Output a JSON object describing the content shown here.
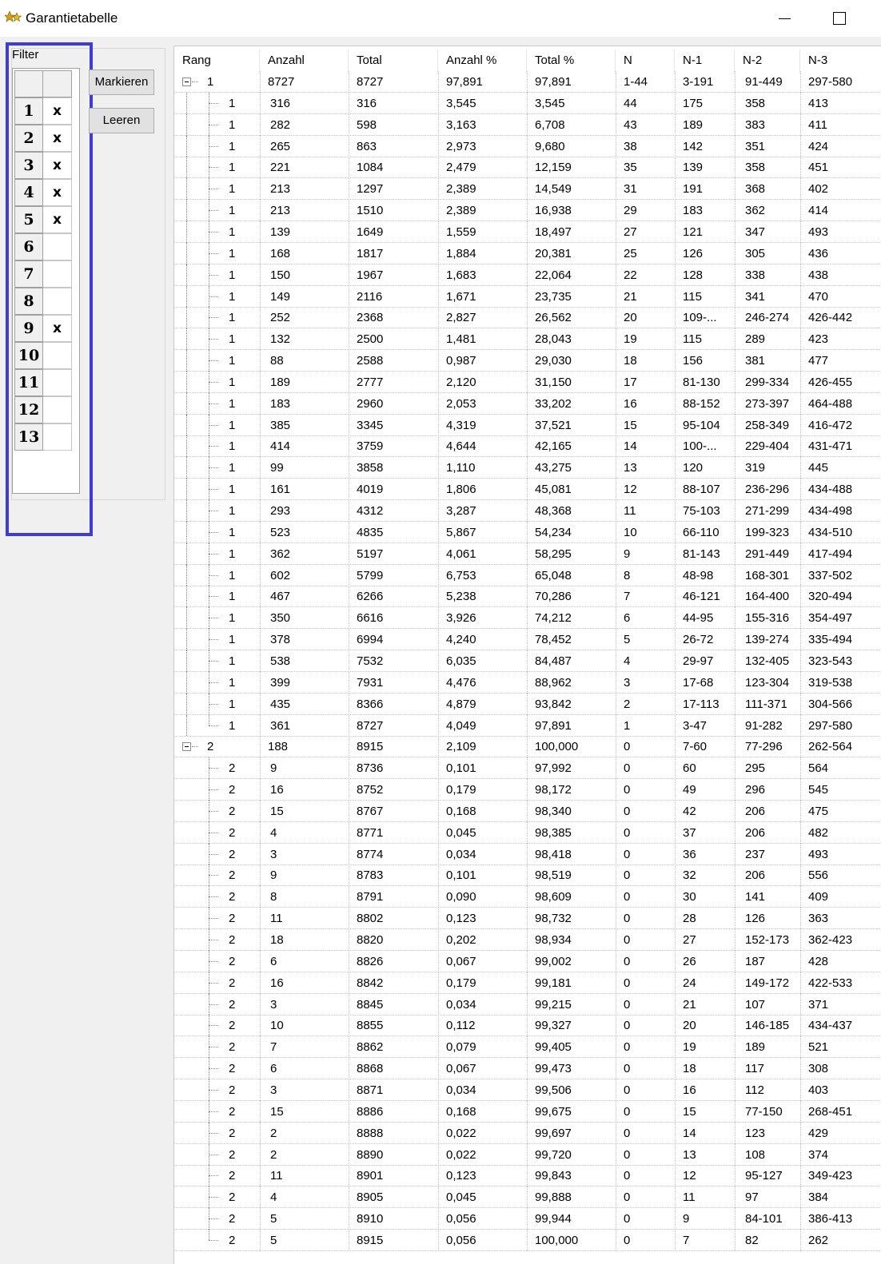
{
  "window": {
    "title": "Garantietabelle",
    "icon": "stars-icon"
  },
  "filter": {
    "caption": "Filter",
    "rows": [
      {
        "num": "1",
        "mark": "x"
      },
      {
        "num": "2",
        "mark": "x"
      },
      {
        "num": "3",
        "mark": "x"
      },
      {
        "num": "4",
        "mark": "x"
      },
      {
        "num": "5",
        "mark": "x"
      },
      {
        "num": "6",
        "mark": ""
      },
      {
        "num": "7",
        "mark": ""
      },
      {
        "num": "8",
        "mark": ""
      },
      {
        "num": "9",
        "mark": "x"
      },
      {
        "num": "10",
        "mark": ""
      },
      {
        "num": "11",
        "mark": ""
      },
      {
        "num": "12",
        "mark": ""
      },
      {
        "num": "13",
        "mark": ""
      }
    ],
    "highlight_color": "#3d3dd6"
  },
  "buttons": {
    "markieren": "Markieren",
    "leeren": "Leeren"
  },
  "table": {
    "columns": [
      "Rang",
      "Anzahl",
      "Total",
      "Anzahl %",
      "Total %",
      "N",
      "N-1",
      "N-2",
      "N-3"
    ],
    "groups": [
      {
        "summary": [
          "1",
          "8727",
          "8727",
          "97,891",
          "97,891",
          "1-44",
          "3-191",
          "91-449",
          "297-580"
        ],
        "children": [
          [
            "1",
            "316",
            "316",
            "3,545",
            "3,545",
            "44",
            "175",
            "358",
            "413"
          ],
          [
            "1",
            "282",
            "598",
            "3,163",
            "6,708",
            "43",
            "189",
            "383",
            "411"
          ],
          [
            "1",
            "265",
            "863",
            "2,973",
            "9,680",
            "38",
            "142",
            "351",
            "424"
          ],
          [
            "1",
            "221",
            "1084",
            "2,479",
            "12,159",
            "35",
            "139",
            "358",
            "451"
          ],
          [
            "1",
            "213",
            "1297",
            "2,389",
            "14,549",
            "31",
            "191",
            "368",
            "402"
          ],
          [
            "1",
            "213",
            "1510",
            "2,389",
            "16,938",
            "29",
            "183",
            "362",
            "414"
          ],
          [
            "1",
            "139",
            "1649",
            "1,559",
            "18,497",
            "27",
            "121",
            "347",
            "493"
          ],
          [
            "1",
            "168",
            "1817",
            "1,884",
            "20,381",
            "25",
            "126",
            "305",
            "436"
          ],
          [
            "1",
            "150",
            "1967",
            "1,683",
            "22,064",
            "22",
            "128",
            "338",
            "438"
          ],
          [
            "1",
            "149",
            "2116",
            "1,671",
            "23,735",
            "21",
            "115",
            "341",
            "470"
          ],
          [
            "1",
            "252",
            "2368",
            "2,827",
            "26,562",
            "20",
            "109-...",
            "246-274",
            "426-442"
          ],
          [
            "1",
            "132",
            "2500",
            "1,481",
            "28,043",
            "19",
            "115",
            "289",
            "423"
          ],
          [
            "1",
            "88",
            "2588",
            "0,987",
            "29,030",
            "18",
            "156",
            "381",
            "477"
          ],
          [
            "1",
            "189",
            "2777",
            "2,120",
            "31,150",
            "17",
            "81-130",
            "299-334",
            "426-455"
          ],
          [
            "1",
            "183",
            "2960",
            "2,053",
            "33,202",
            "16",
            "88-152",
            "273-397",
            "464-488"
          ],
          [
            "1",
            "385",
            "3345",
            "4,319",
            "37,521",
            "15",
            "95-104",
            "258-349",
            "416-472"
          ],
          [
            "1",
            "414",
            "3759",
            "4,644",
            "42,165",
            "14",
            "100-...",
            "229-404",
            "431-471"
          ],
          [
            "1",
            "99",
            "3858",
            "1,110",
            "43,275",
            "13",
            "120",
            "319",
            "445"
          ],
          [
            "1",
            "161",
            "4019",
            "1,806",
            "45,081",
            "12",
            "88-107",
            "236-296",
            "434-488"
          ],
          [
            "1",
            "293",
            "4312",
            "3,287",
            "48,368",
            "11",
            "75-103",
            "271-299",
            "434-498"
          ],
          [
            "1",
            "523",
            "4835",
            "5,867",
            "54,234",
            "10",
            "66-110",
            "199-323",
            "434-510"
          ],
          [
            "1",
            "362",
            "5197",
            "4,061",
            "58,295",
            "9",
            "81-143",
            "291-449",
            "417-494"
          ],
          [
            "1",
            "602",
            "5799",
            "6,753",
            "65,048",
            "8",
            "48-98",
            "168-301",
            "337-502"
          ],
          [
            "1",
            "467",
            "6266",
            "5,238",
            "70,286",
            "7",
            "46-121",
            "164-400",
            "320-494"
          ],
          [
            "1",
            "350",
            "6616",
            "3,926",
            "74,212",
            "6",
            "44-95",
            "155-316",
            "354-497"
          ],
          [
            "1",
            "378",
            "6994",
            "4,240",
            "78,452",
            "5",
            "26-72",
            "139-274",
            "335-494"
          ],
          [
            "1",
            "538",
            "7532",
            "6,035",
            "84,487",
            "4",
            "29-97",
            "132-405",
            "323-543"
          ],
          [
            "1",
            "399",
            "7931",
            "4,476",
            "88,962",
            "3",
            "17-68",
            "123-304",
            "319-538"
          ],
          [
            "1",
            "435",
            "8366",
            "4,879",
            "93,842",
            "2",
            "17-113",
            "111-371",
            "304-566"
          ],
          [
            "1",
            "361",
            "8727",
            "4,049",
            "97,891",
            "1",
            "3-47",
            "91-282",
            "297-580"
          ]
        ]
      },
      {
        "summary": [
          "2",
          "188",
          "8915",
          "2,109",
          "100,000",
          "0",
          "7-60",
          "77-296",
          "262-564"
        ],
        "children": [
          [
            "2",
            "9",
            "8736",
            "0,101",
            "97,992",
            "0",
            "60",
            "295",
            "564"
          ],
          [
            "2",
            "16",
            "8752",
            "0,179",
            "98,172",
            "0",
            "49",
            "296",
            "545"
          ],
          [
            "2",
            "15",
            "8767",
            "0,168",
            "98,340",
            "0",
            "42",
            "206",
            "475"
          ],
          [
            "2",
            "4",
            "8771",
            "0,045",
            "98,385",
            "0",
            "37",
            "206",
            "482"
          ],
          [
            "2",
            "3",
            "8774",
            "0,034",
            "98,418",
            "0",
            "36",
            "237",
            "493"
          ],
          [
            "2",
            "9",
            "8783",
            "0,101",
            "98,519",
            "0",
            "32",
            "206",
            "556"
          ],
          [
            "2",
            "8",
            "8791",
            "0,090",
            "98,609",
            "0",
            "30",
            "141",
            "409"
          ],
          [
            "2",
            "11",
            "8802",
            "0,123",
            "98,732",
            "0",
            "28",
            "126",
            "363"
          ],
          [
            "2",
            "18",
            "8820",
            "0,202",
            "98,934",
            "0",
            "27",
            "152-173",
            "362-423"
          ],
          [
            "2",
            "6",
            "8826",
            "0,067",
            "99,002",
            "0",
            "26",
            "187",
            "428"
          ],
          [
            "2",
            "16",
            "8842",
            "0,179",
            "99,181",
            "0",
            "24",
            "149-172",
            "422-533"
          ],
          [
            "2",
            "3",
            "8845",
            "0,034",
            "99,215",
            "0",
            "21",
            "107",
            "371"
          ],
          [
            "2",
            "10",
            "8855",
            "0,112",
            "99,327",
            "0",
            "20",
            "146-185",
            "434-437"
          ],
          [
            "2",
            "7",
            "8862",
            "0,079",
            "99,405",
            "0",
            "19",
            "189",
            "521"
          ],
          [
            "2",
            "6",
            "8868",
            "0,067",
            "99,473",
            "0",
            "18",
            "117",
            "308"
          ],
          [
            "2",
            "3",
            "8871",
            "0,034",
            "99,506",
            "0",
            "16",
            "112",
            "403"
          ],
          [
            "2",
            "15",
            "8886",
            "0,168",
            "99,675",
            "0",
            "15",
            "77-150",
            "268-451"
          ],
          [
            "2",
            "2",
            "8888",
            "0,022",
            "99,697",
            "0",
            "14",
            "123",
            "429"
          ],
          [
            "2",
            "2",
            "8890",
            "0,022",
            "99,720",
            "0",
            "13",
            "108",
            "374"
          ],
          [
            "2",
            "11",
            "8901",
            "0,123",
            "99,843",
            "0",
            "12",
            "95-127",
            "349-423"
          ],
          [
            "2",
            "4",
            "8905",
            "0,045",
            "99,888",
            "0",
            "11",
            "97",
            "384"
          ],
          [
            "2",
            "5",
            "8910",
            "0,056",
            "99,944",
            "0",
            "9",
            "84-101",
            "386-413"
          ],
          [
            "2",
            "5",
            "8915",
            "0,056",
            "100,000",
            "0",
            "7",
            "82",
            "262"
          ]
        ]
      }
    ]
  }
}
